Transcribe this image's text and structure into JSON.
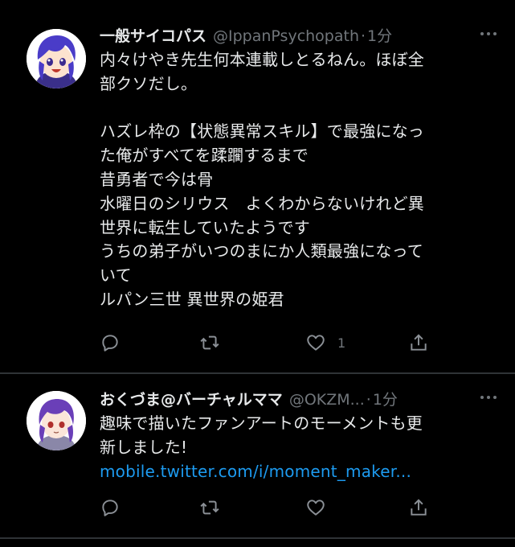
{
  "tweets": [
    {
      "name": "一般サイコパス",
      "handle": "@IppanPsychopath",
      "dot": "·",
      "time": "1分",
      "text": "内々けやき先生何本連載しとるねん。ほぼ全\n部クソだし。\n\nハズレ枠の【状態異常スキル】で最強になっ\nた俺がすべてを蹂躙するまで\n昔勇者で今は骨\n水曜日のシリウス　よくわからないけれど異\n世界に転生していたようです\nうちの弟子がいつのまにか人類最強になって\nいて\nルパン三世 異世界の姫君",
      "like_count": "1",
      "icons": [
        "reply-icon",
        "retweet-icon",
        "like-icon",
        "share-icon"
      ]
    },
    {
      "name": "おくづま@バーチャルママ",
      "handle": "@OKZM...",
      "dot": "·",
      "time": "1分",
      "text": "趣味で描いたファンアートのモーメントも更\n新しました!",
      "link": "mobile.twitter.com/i/moment_maker...",
      "icons": [
        "reply-icon",
        "retweet-icon",
        "like-icon",
        "share-icon"
      ]
    }
  ],
  "colors": {
    "background": "#000000",
    "text": "#e7e9ea",
    "muted": "#71767b",
    "link": "#1d9bf0",
    "divider": "#2f3336"
  }
}
